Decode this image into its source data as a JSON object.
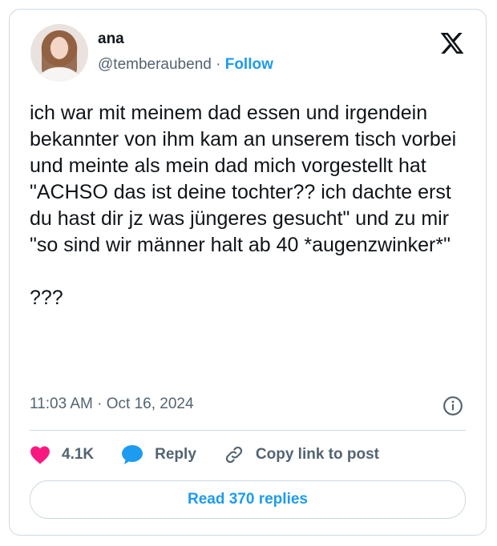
{
  "author": {
    "name": "ana",
    "handle": "@temberaubend",
    "separator": "·",
    "follow_label": "Follow"
  },
  "tweet": {
    "text": "ich war mit meinem dad essen und irgendein bekannter von ihm kam an unserem tisch vorbei und meinte als mein dad mich vorgestellt hat \"ACHSO das ist deine tochter?? ich dachte erst du hast dir jz was jüngeres gesucht\" und zu mir \"so sind wir männer halt ab 40 *augenzwinker*\"\n\n???",
    "timestamp": "11:03 AM · Oct 16, 2024"
  },
  "actions": {
    "likes_count": "4.1K",
    "reply_label": "Reply",
    "copy_link_label": "Copy link to post"
  },
  "read_replies_label": "Read 370 replies",
  "icons": {
    "logo": "x-logo-icon",
    "info": "info-icon",
    "like": "heart-icon",
    "reply": "speech-bubble-icon",
    "copy_link": "link-icon"
  },
  "colors": {
    "accent": "#1d9bf0",
    "like": "#f91880",
    "secondary_text": "#536471",
    "border": "#cfd9de"
  }
}
